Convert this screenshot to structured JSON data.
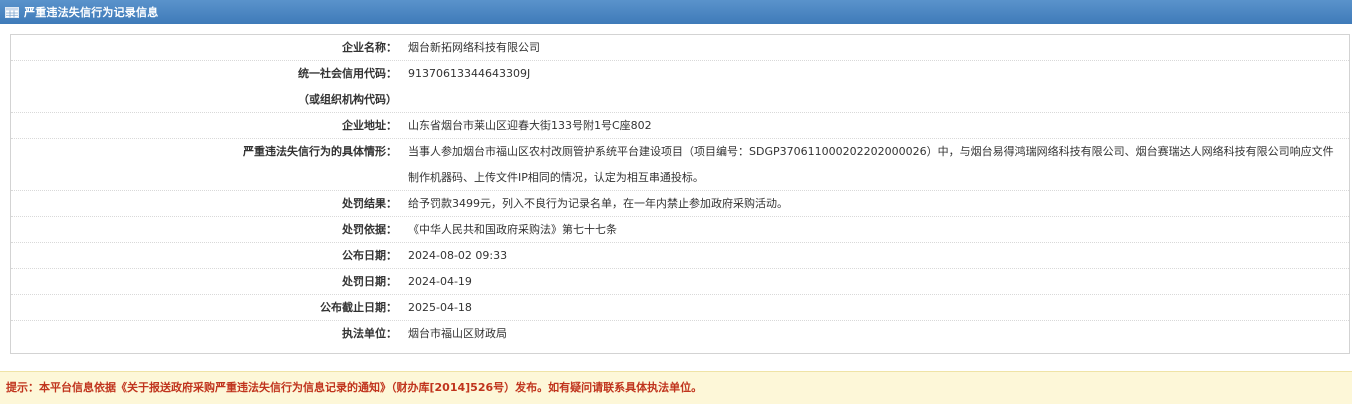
{
  "header": {
    "title": "严重违法失信行为记录信息",
    "icon": "table-icon"
  },
  "record": {
    "company_name": {
      "label": "企业名称：",
      "value": "烟台新拓网络科技有限公司"
    },
    "credit_code": {
      "label": "统一社会信用代码：",
      "label_sub": "（或组织机构代码）",
      "value": "91370613344643309J"
    },
    "address": {
      "label": "企业地址：",
      "value": "山东省烟台市莱山区迎春大街133号附1号C座802"
    },
    "situation": {
      "label": "严重违法失信行为的具体情形：",
      "value": "当事人参加烟台市福山区农村改厕管护系统平台建设项目（项目编号：SDGP370611000202202000026）中，与烟台易得鸿瑞网络科技有限公司、烟台赛瑞达人网络科技有限公司响应文件制作机器码、上传文件IP相同的情况，认定为相互串通投标。"
    },
    "penalty_result": {
      "label": "处罚结果：",
      "value": "给予罚款3499元，列入不良行为记录名单，在一年内禁止参加政府采购活动。"
    },
    "penalty_basis": {
      "label": "处罚依据：",
      "value": "《中华人民共和国政府采购法》第七十七条"
    },
    "publish_date": {
      "label": "公布日期：",
      "value": "2024-08-02 09:33"
    },
    "penalty_date": {
      "label": "处罚日期：",
      "value": "2024-04-19"
    },
    "publish_end_date": {
      "label": "公布截止日期：",
      "value": "2025-04-18"
    },
    "enforcement_unit": {
      "label": "执法单位：",
      "value": "烟台市福山区财政局"
    }
  },
  "notice": {
    "text": "提示：本平台信息依据《关于报送政府采购严重违法失信行为信息记录的通知》（财办库[2014]526号）发布。如有疑问请联系具体执法单位。"
  },
  "colors": {
    "header_bg": "#4a86c3",
    "notice_bg": "#fdf7d8",
    "notice_text": "#c0341d"
  }
}
